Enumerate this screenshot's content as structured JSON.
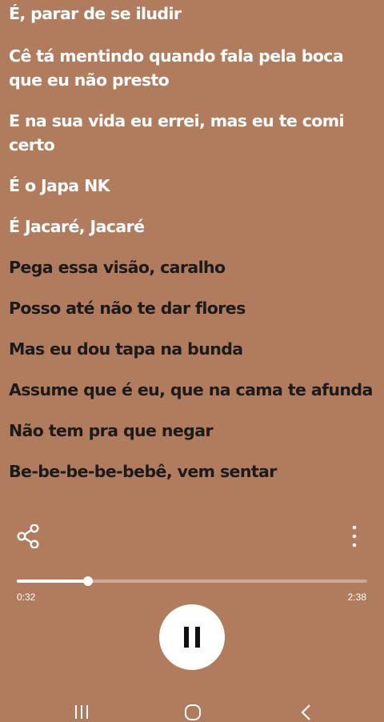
{
  "lyrics": [
    {
      "text": "É, parar de se iludir",
      "state": "past"
    },
    {
      "text": "Cê tá mentindo quando fala pela boca que eu não presto",
      "state": "past"
    },
    {
      "text": "E na sua vida eu errei, mas eu te comi certo",
      "state": "past"
    },
    {
      "text": "É o Japa NK",
      "state": "past"
    },
    {
      "text": "É Jacaré, Jacaré",
      "state": "past"
    },
    {
      "text": "Pega essa visão, caralho",
      "state": "upcoming"
    },
    {
      "text": "Posso até não te dar flores",
      "state": "upcoming"
    },
    {
      "text": "Mas eu dou tapa na bunda",
      "state": "upcoming"
    },
    {
      "text": "Assume que é eu, que na cama te afunda",
      "state": "upcoming"
    },
    {
      "text": "Não tem pra que negar",
      "state": "upcoming"
    },
    {
      "text": "Be-be-be-be-bebê, vem sentar",
      "state": "upcoming"
    }
  ],
  "player": {
    "elapsed": "0:32",
    "duration": "2:38",
    "progress": 0.203,
    "state": "playing"
  },
  "icons": {
    "share": "share-icon",
    "more": "more-vertical-icon",
    "pause": "pause-icon",
    "nav_recents": "recents-icon",
    "nav_home": "home-icon",
    "nav_back": "back-icon"
  },
  "colors": {
    "background": "#b17b5e",
    "sung_lyric": "#ffffff",
    "upcoming_lyric": "#1b1b1b"
  }
}
